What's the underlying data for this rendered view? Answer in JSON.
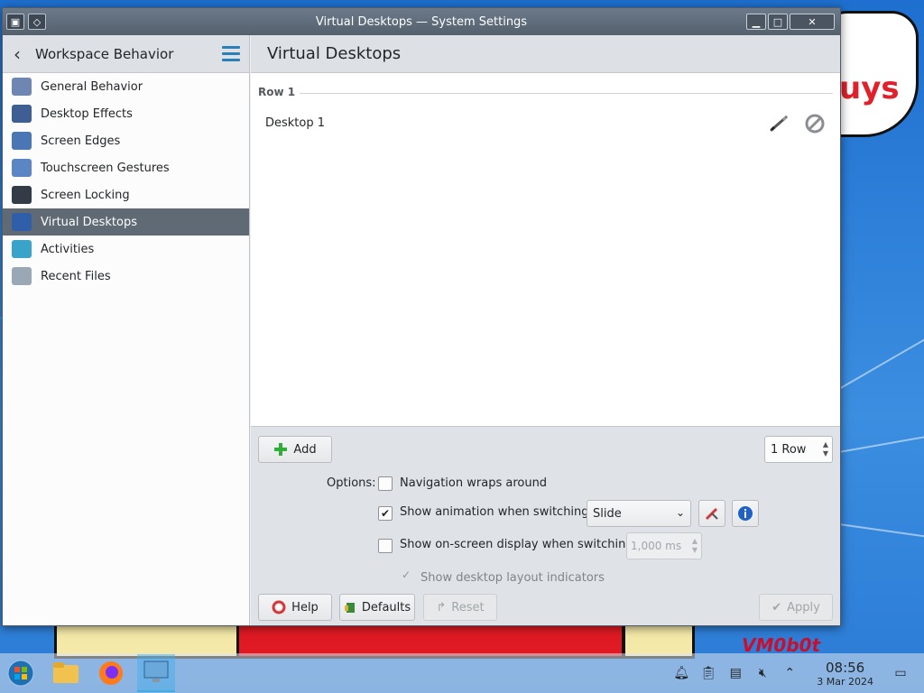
{
  "window": {
    "title": "Virtual Desktops — System Settings"
  },
  "sidebar": {
    "header": "Workspace Behavior",
    "items": [
      {
        "label": "General Behavior",
        "icon": "general-behavior-icon",
        "color": "#6f86b3"
      },
      {
        "label": "Desktop Effects",
        "icon": "desktop-effects-icon",
        "color": "#3f5e92"
      },
      {
        "label": "Screen Edges",
        "icon": "screen-edges-icon",
        "color": "#4877b4"
      },
      {
        "label": "Touchscreen Gestures",
        "icon": "touchscreen-gestures-icon",
        "color": "#5a86c4"
      },
      {
        "label": "Screen Locking",
        "icon": "screen-locking-icon",
        "color": "#333c46"
      },
      {
        "label": "Virtual Desktops",
        "icon": "virtual-desktops-icon",
        "color": "#2f5fa8",
        "active": true
      },
      {
        "label": "Activities",
        "icon": "activities-icon",
        "color": "#3aa3c9"
      },
      {
        "label": "Recent Files",
        "icon": "recent-files-icon",
        "color": "#9aa7b4"
      }
    ]
  },
  "main": {
    "title": "Virtual Desktops",
    "row_label": "Row 1",
    "desktops": [
      "Desktop 1"
    ],
    "add_label": "Add",
    "rows_value": "1 Row",
    "options_label": "Options:",
    "opt_wrap": "Navigation wraps around",
    "opt_animation": "Show animation when switching:",
    "animation_value": "Slide",
    "opt_osd": "Show on-screen display when switching:",
    "osd_value": "1,000 ms",
    "opt_layout": "Show desktop layout indicators",
    "help_label": "Help",
    "defaults_label": "Defaults",
    "reset_label": "Reset",
    "apply_label": "Apply"
  },
  "wallpaper": {
    "cloud_text": "uys",
    "signature": "VM0b0t"
  },
  "taskbar": {
    "time": "08:56",
    "date": "3 Mar 2024"
  },
  "colors": {
    "accent": "#3daee9",
    "selection": "#5f6a74"
  }
}
